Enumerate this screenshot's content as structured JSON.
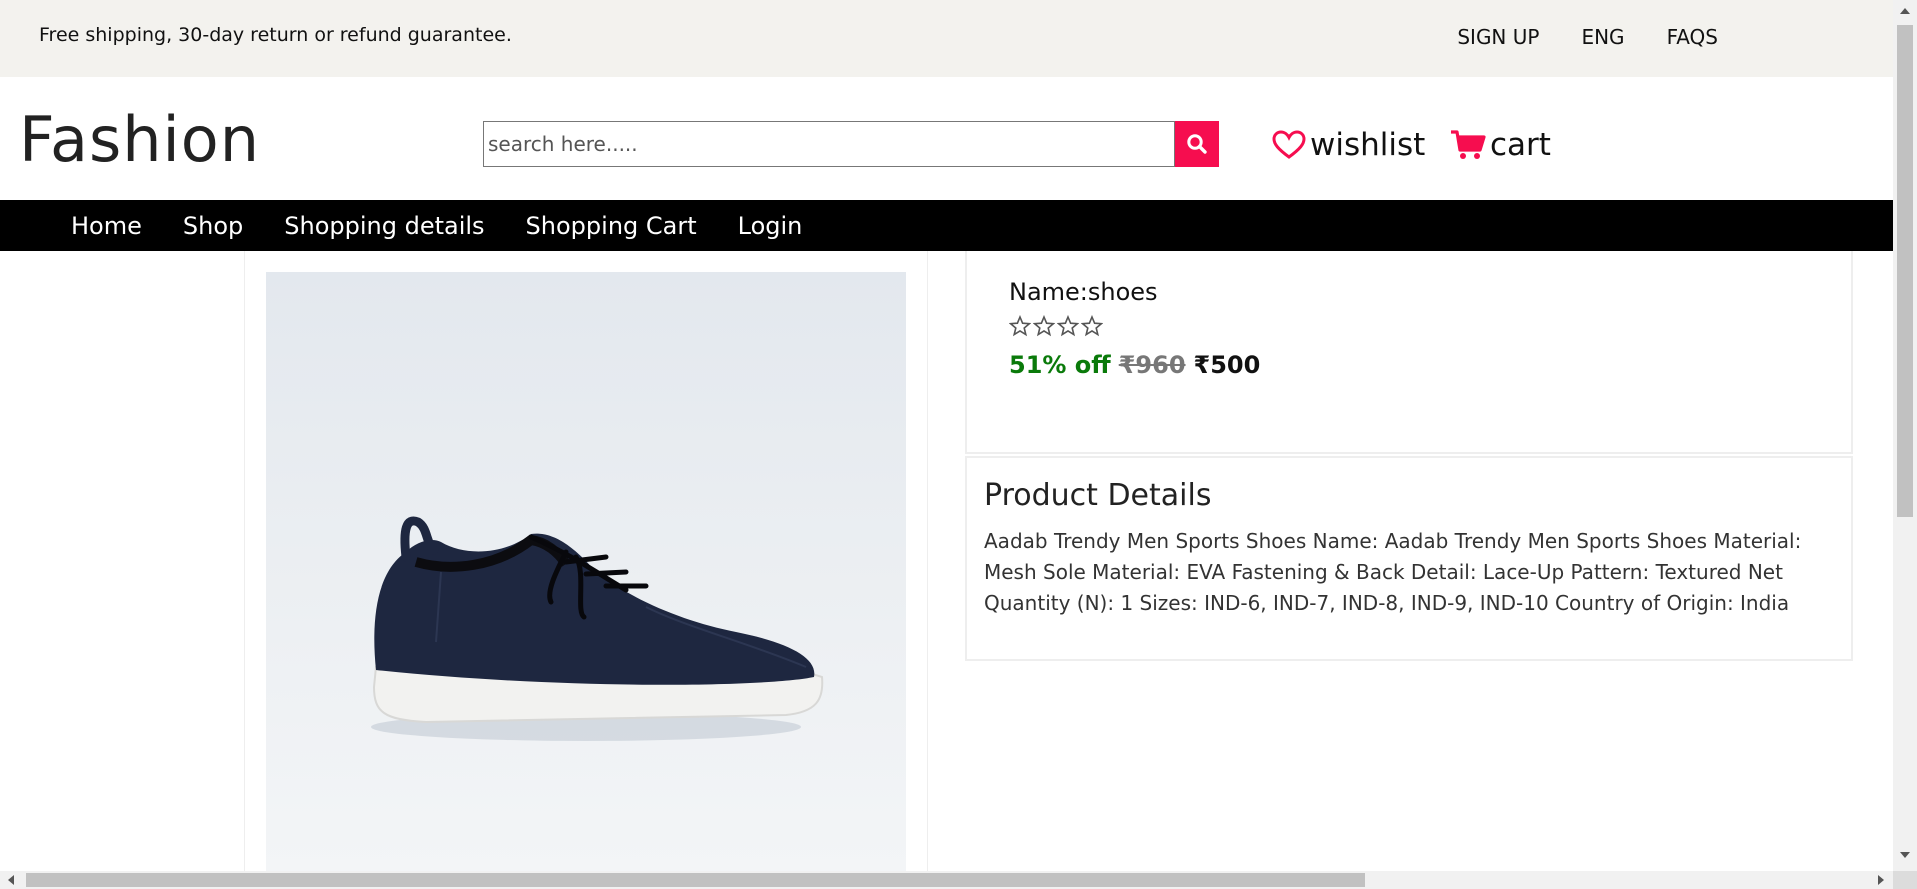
{
  "topbar": {
    "promo": "Free shipping, 30-day return or refund guarantee.",
    "links": [
      "SIGN UP",
      "ENG",
      "FAQS"
    ]
  },
  "header": {
    "logo": "Fashion",
    "search_placeholder": "search here.....",
    "wishlist_label": "wishlist",
    "cart_label": "cart",
    "accent_color": "#f60d4f"
  },
  "nav": {
    "items": [
      "Home",
      "Shop",
      "Shopping details",
      "Shopping Cart",
      "Login"
    ]
  },
  "product": {
    "name": "Name:shoes",
    "rating_stars": 0,
    "rating_max": 5,
    "discount": "51% off",
    "old_price": "₹960",
    "price": "₹500",
    "image_icon": "sneaker-image"
  },
  "details": {
    "title": "Product Details",
    "text": "Aadab Trendy Men Sports Shoes Name: Aadab Trendy Men Sports Shoes Material: Mesh Sole Material: EVA Fastening & Back Detail: Lace-Up Pattern: Textured Net Quantity (N): 1 Sizes: IND-6, IND-7, IND-8, IND-9, IND-10 Country of Origin: India"
  }
}
